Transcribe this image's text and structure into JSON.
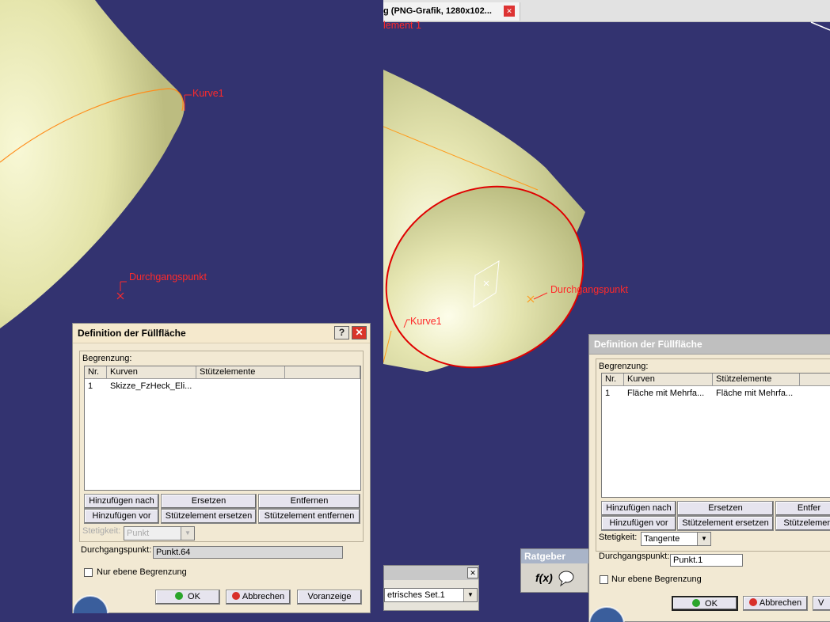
{
  "left": {
    "labels": {
      "curve": "Kurve1",
      "point": "Durchgangspunkt"
    },
    "dialog": {
      "title": "Definition der Füllfläche",
      "help": "?",
      "close": "✕",
      "group_label": "Begrenzung:",
      "columns": [
        "Nr.",
        "Kurven",
        "Stützelemente"
      ],
      "rows": [
        {
          "nr": "1",
          "kurven": "Skizze_FzHeck_Eli...",
          "stuetz": ""
        }
      ],
      "buttons": {
        "add_after": "Hinzufügen nach",
        "replace": "Ersetzen",
        "remove": "Entfernen",
        "add_before": "Hinzufügen vor",
        "replace_support": "Stützelement ersetzen",
        "remove_support": "Stützelement entfernen"
      },
      "continuity_label": "Stetigkeit:",
      "continuity_value": "Punkt",
      "passing_label": "Durchgangspunkt:",
      "passing_value": "Punkt.64",
      "planar_label": "Nur ebene Begrenzung",
      "ok": "OK",
      "cancel": "Abbrechen",
      "preview": "Voranzeige"
    }
  },
  "right": {
    "tab_title": "g (PNG-Grafik, 1280x102...",
    "tab_close": "✕",
    "top_label": "lement 1",
    "nav_arrow": "‹",
    "labels": {
      "curve": "Kurve1",
      "point": "Durchgangspunkt"
    },
    "set_select": "etrisches Set.1",
    "set_close": "✕",
    "advisor_title": "Ratgeber",
    "advisor_formula": "f(x)",
    "dialog": {
      "title": "Definition der Füllfläche",
      "group_label": "Begrenzung:",
      "columns": [
        "Nr.",
        "Kurven",
        "Stützelemente"
      ],
      "rows": [
        {
          "nr": "1",
          "kurven": "Fläche mit Mehrfa...",
          "stuetz": "Fläche mit Mehrfa..."
        }
      ],
      "buttons": {
        "add_after": "Hinzufügen nach",
        "replace": "Ersetzen",
        "remove": "Entfer",
        "add_before": "Hinzufügen vor",
        "replace_support": "Stützelement ersetzen",
        "remove_support": "Stützelement"
      },
      "continuity_label": "Stetigkeit:",
      "continuity_value": "Tangente",
      "passing_label": "Durchgangspunkt:",
      "passing_value": "Punkt.1",
      "planar_label": "Nur ebene Begrenzung",
      "ok": "OK",
      "cancel": "Abbrechen",
      "preview": "V"
    }
  },
  "colors": {
    "viewport": "#333370",
    "surface": "#e8e8b0",
    "curve": "#ff0000",
    "dialog": "#f2e9d3"
  }
}
